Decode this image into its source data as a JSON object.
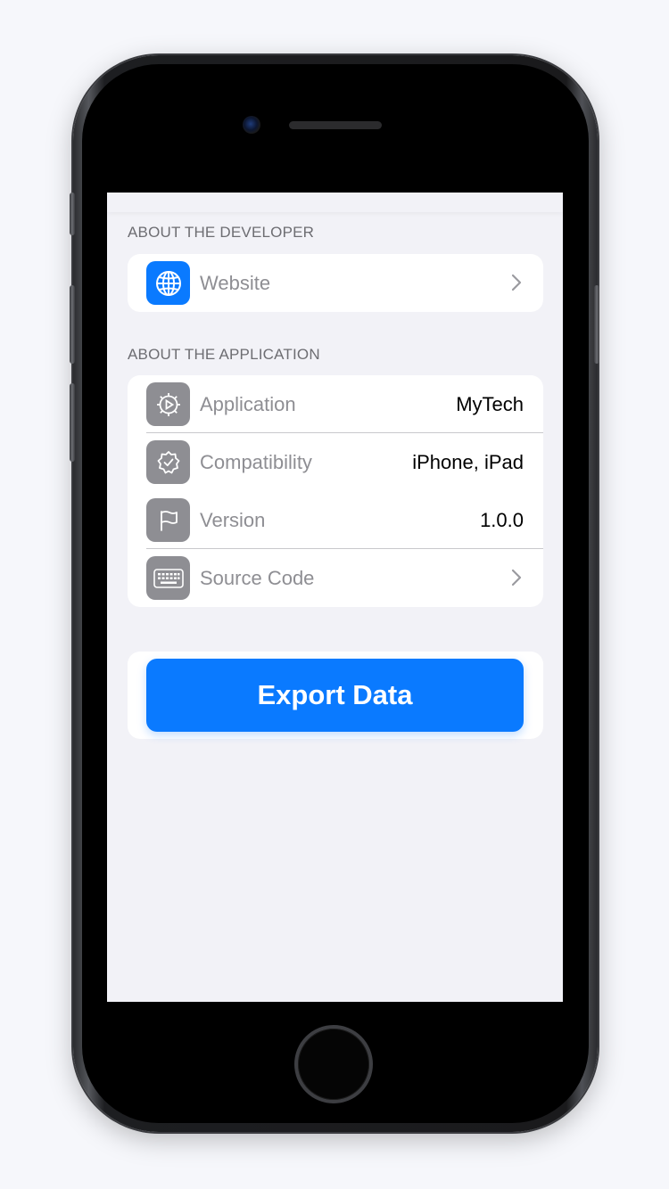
{
  "developer_section": {
    "header": "ABOUT THE DEVELOPER",
    "items": [
      {
        "label": "Website",
        "icon": "globe-icon",
        "icon_color": "#0a7aff",
        "accessory": "chevron"
      }
    ]
  },
  "application_section": {
    "header": "ABOUT THE APPLICATION",
    "items": [
      {
        "label": "Application",
        "value": "MyTech",
        "icon": "gear-icon"
      },
      {
        "label": "Compatibility",
        "value": "iPhone, iPad",
        "icon": "checkmark-seal-icon"
      },
      {
        "label": "Version",
        "value": "1.0.0",
        "icon": "flag-icon"
      },
      {
        "label": "Source Code",
        "icon": "keyboard-icon",
        "accessory": "chevron"
      }
    ]
  },
  "export": {
    "label": "Export Data"
  },
  "colors": {
    "accent": "#0a7aff",
    "background": "#f2f2f7",
    "icon_gray": "#8e8e93",
    "secondary_text": "#8e8e93"
  }
}
